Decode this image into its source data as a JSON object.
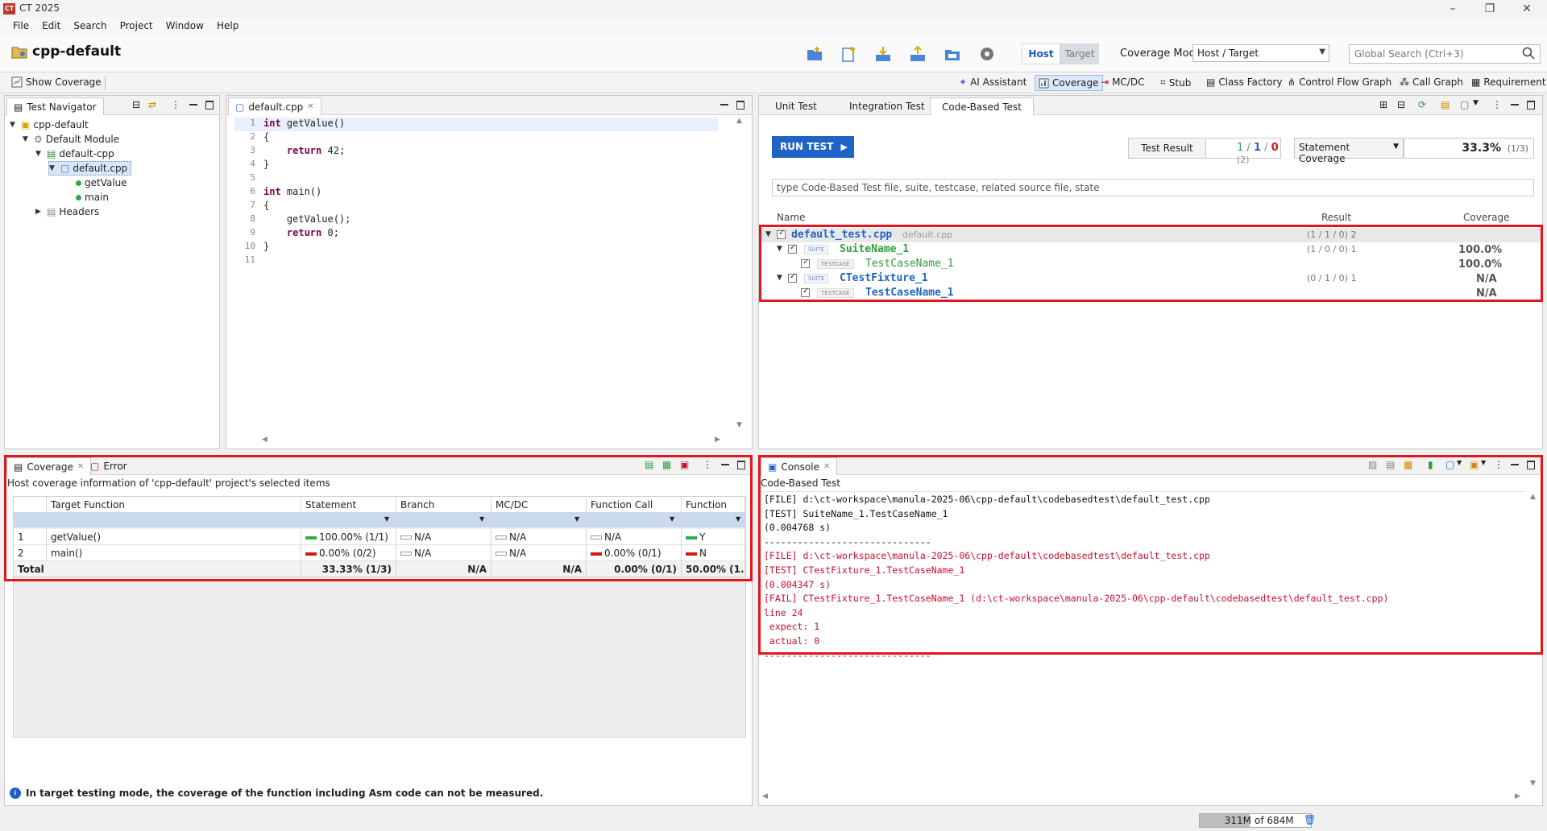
{
  "window": {
    "title": "CT 2025",
    "logo": "CT"
  },
  "menu": [
    "File",
    "Edit",
    "Search",
    "Project",
    "Window",
    "Help"
  ],
  "project": {
    "name": "cpp-default"
  },
  "mode": {
    "host": "Host",
    "target": "Target"
  },
  "coverage_mode": {
    "label": "Coverage Mode",
    "value": "Host / Target"
  },
  "global_search": {
    "placeholder": "Global Search (Ctrl+3)"
  },
  "secondary": {
    "show_coverage": "Show Coverage",
    "items": [
      "AI Assistant",
      "Coverage",
      "MC/DC",
      "Stub",
      "Class Factory",
      "Control Flow Graph",
      "Call Graph",
      "Requirement"
    ]
  },
  "navigator": {
    "tab": "Test Navigator",
    "tree": [
      {
        "label": "cpp-default"
      },
      {
        "label": "Default Module"
      },
      {
        "label": "default-cpp"
      },
      {
        "label": "default.cpp"
      },
      {
        "label": "getValue"
      },
      {
        "label": "main"
      },
      {
        "label": "Headers"
      }
    ]
  },
  "editor": {
    "tab": "default.cpp",
    "lines": [
      {
        "n": "1",
        "code": "int getValue()"
      },
      {
        "n": "2",
        "code": "{"
      },
      {
        "n": "3",
        "code": "    return 42;"
      },
      {
        "n": "4",
        "code": "}"
      },
      {
        "n": "5",
        "code": ""
      },
      {
        "n": "6",
        "code": "int main()"
      },
      {
        "n": "7",
        "code": "{"
      },
      {
        "n": "8",
        "code": "    getValue();"
      },
      {
        "n": "9",
        "code": "    return 0;"
      },
      {
        "n": "10",
        "code": "}"
      },
      {
        "n": "11",
        "code": ""
      }
    ]
  },
  "test_panel": {
    "tabs": [
      "Unit Test",
      "Integration Test",
      "Code-Based Test"
    ],
    "run_button": "RUN TEST",
    "test_result_label": "Test Result",
    "result_pass": "1",
    "result_sep": "/",
    "result_skip": "1",
    "result_fail": "0",
    "result_total": "(2)",
    "coverage_select": "Statement Coverage",
    "coverage_value": "33.3%",
    "coverage_ratio": "(1/3)",
    "filter_placeholder": "type Code-Based Test file, suite, testcase, related source file, state",
    "columns": {
      "name": "Name",
      "result": "Result",
      "coverage": "Coverage"
    },
    "rows": [
      {
        "name": "default_test.cpp",
        "sub": "default.cpp",
        "result": "(1 / 1 / 0) 2",
        "coverage": ""
      },
      {
        "tag": "SUITE",
        "name": "SuiteName_1",
        "result": "(1 / 0 / 0) 1",
        "coverage": "100.0%"
      },
      {
        "tag": "TESTCASE",
        "name": "TestCaseName_1",
        "result": "",
        "coverage": "100.0%"
      },
      {
        "tag": "SUITE",
        "name": "CTestFixture_1",
        "result": "(0 / 1 / 0) 1",
        "coverage": "N/A"
      },
      {
        "tag": "TESTCASE",
        "name": "TestCaseName_1",
        "result": "",
        "coverage": "N/A"
      }
    ]
  },
  "coverage_panel": {
    "tabs": [
      "Coverage",
      "Error"
    ],
    "info": "Host coverage information of 'cpp-default' project's selected items",
    "columns": [
      "Target Function",
      "Statement",
      "Branch",
      "MC/DC",
      "Function Call",
      "Function"
    ],
    "rows": [
      {
        "idx": "1",
        "fn": "getValue()",
        "statement": "100.00% (1/1)",
        "branch": "N/A",
        "mcdc": "N/A",
        "call": "N/A",
        "function": "Y"
      },
      {
        "idx": "2",
        "fn": "main()",
        "statement": "0.00% (0/2)",
        "branch": "N/A",
        "mcdc": "N/A",
        "call": "0.00% (0/1)",
        "function": "N"
      }
    ],
    "total": {
      "label": "Total",
      "statement": "33.33% (1/3)",
      "branch": "N/A",
      "mcdc": "N/A",
      "call": "0.00% (0/1)",
      "function": "50.00% (1..."
    },
    "note": "In target testing mode, the coverage of the function including Asm code can not be measured."
  },
  "console": {
    "tab": "Console",
    "header": "Code-Based Test",
    "lines": [
      {
        "text": "[FILE] d:\\ct-workspace\\manula-2025-06\\cpp-default\\codebasedtest\\default_test.cpp",
        "color": "#111111"
      },
      {
        "text": "[TEST] SuiteName_1.TestCaseName_1",
        "color": "#111111"
      },
      {
        "text": "(0.004768 s)",
        "color": "#111111"
      },
      {
        "text": "------------------------------",
        "color": "#111111"
      },
      {
        "text": "[FILE] d:\\ct-workspace\\manula-2025-06\\cpp-default\\codebasedtest\\default_test.cpp",
        "color": "#c8102e"
      },
      {
        "text": "[TEST] CTestFixture_1.TestCaseName_1",
        "color": "#c8102e"
      },
      {
        "text": "(0.004347 s)",
        "color": "#c8102e"
      },
      {
        "text": "[FAIL] CTestFixture_1.TestCaseName_1 (d:\\ct-workspace\\manula-2025-06\\cpp-default\\codebasedtest\\default_test.cpp)",
        "color": "#c8102e"
      },
      {
        "text": "line 24",
        "color": "#c8102e"
      },
      {
        "text": " expect: 1",
        "color": "#c8102e"
      },
      {
        "text": " actual: 0",
        "color": "#c8102e"
      },
      {
        "text": "------------------------------",
        "color": "#c8102e"
      }
    ]
  },
  "status": {
    "heap_used": "311M",
    "heap_total": "of 684M",
    "heap_fraction": 0.45
  },
  "colors": {
    "accent": "#1f63c6",
    "highlight": "#e3151c",
    "pass": "#2eb04a",
    "fail": "#d01a1a"
  }
}
